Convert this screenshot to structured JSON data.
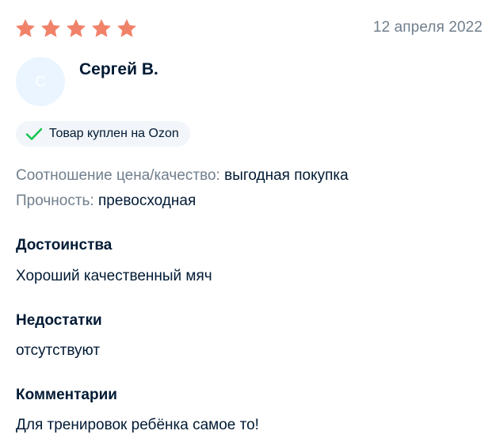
{
  "review": {
    "rating": 5,
    "rating_max": 5,
    "star_color": "#f1826a",
    "date": "12 апреля 2022",
    "author": {
      "initial": "С",
      "name": "Сергей В."
    },
    "verified_badge": {
      "label": "Товар куплен на Ozon",
      "icon": "check-icon",
      "icon_color": "#10c44c"
    },
    "attributes": [
      {
        "key": "Соотношение цена/качество:",
        "value": "выгодная покупка"
      },
      {
        "key": "Прочность:",
        "value": "превосходная"
      }
    ],
    "sections": [
      {
        "title": "Достоинства",
        "text": "Хороший качественный мяч"
      },
      {
        "title": "Недостатки",
        "text": "отсутствуют"
      },
      {
        "title": "Комментарии",
        "text": "Для тренировок ребёнка самое то!"
      }
    ]
  }
}
